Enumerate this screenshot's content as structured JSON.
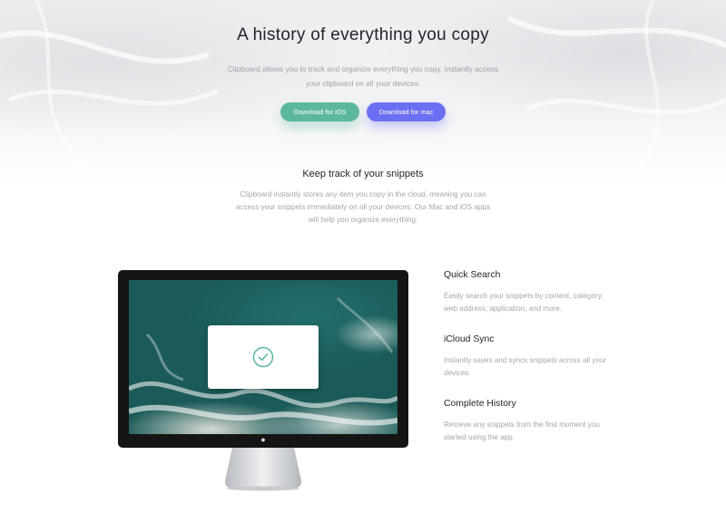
{
  "hero": {
    "title": "A history of everything you copy",
    "subtitle": "Clipboard allows you to track and organize everything you copy. Instantly access your clipboard on all your devices.",
    "buttons": {
      "ios_label": "Download for iOS",
      "mac_label": "Download for mac"
    }
  },
  "snippets": {
    "title": "Keep track of your snippets",
    "text": "Clipboard instantly stores any item you copy in the cloud, meaning you can access your snippets immediately on all your devices. Our Mac and iOS apps will help you organize everything."
  },
  "features": [
    {
      "title": "Quick Search",
      "text": "Easily search your snippets by content, category, web address, application, and more."
    },
    {
      "title": "iCloud Sync",
      "text": "Instantly saves and syncs snippets across all your devices."
    },
    {
      "title": "Complete History",
      "text": "Retrieve any snippets from the first moment you started using the app."
    }
  ],
  "colors": {
    "ios_button": "#5db6a0",
    "mac_button": "#6c6ff2",
    "heading": "#22252b",
    "body_text": "#a2a6ac"
  },
  "icons": {
    "monitor_modal": "check-circle-icon",
    "monitor_logo": "apple-logo-icon"
  }
}
